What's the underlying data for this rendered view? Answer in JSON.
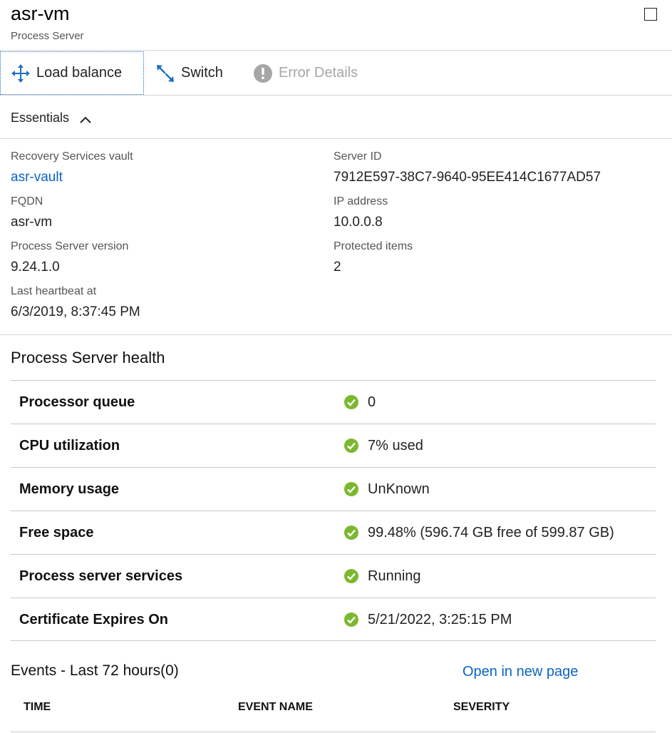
{
  "header": {
    "title": "asr-vm",
    "subtitle": "Process Server"
  },
  "toolbar": {
    "load_balance": "Load balance",
    "switch": "Switch",
    "error_details": "Error Details"
  },
  "essentials": {
    "label": "Essentials",
    "left": [
      {
        "label": "Recovery Services vault",
        "value": "asr-vault"
      },
      {
        "label": "FQDN",
        "value": "asr-vm"
      },
      {
        "label": "Process Server version",
        "value": "9.24.1.0"
      },
      {
        "label": "Last heartbeat at",
        "value": "6/3/2019, 8:37:45 PM"
      }
    ],
    "right": [
      {
        "label": "Server ID",
        "value": "7912E597-38C7-9640-95EE414C1677AD57"
      },
      {
        "label": "IP address",
        "value": "10.0.0.8"
      },
      {
        "label": "Protected items",
        "value": "2"
      }
    ]
  },
  "health": {
    "title": "Process Server health",
    "rows": [
      {
        "label": "Processor queue",
        "value": "0",
        "status": "ok"
      },
      {
        "label": "CPU utilization",
        "value": "7% used",
        "status": "ok"
      },
      {
        "label": "Memory usage",
        "value": "UnKnown",
        "status": "ok"
      },
      {
        "label": "Free space",
        "value": "99.48% (596.74 GB free of 599.87 GB)",
        "status": "ok"
      },
      {
        "label": "Process server services",
        "value": "Running",
        "status": "ok"
      },
      {
        "label": "Certificate Expires On",
        "value": "5/21/2022, 3:25:15 PM",
        "status": "ok"
      }
    ]
  },
  "events": {
    "title": "Events - Last 72 hours(0)",
    "open_link": "Open in new page",
    "columns": [
      "TIME",
      "EVENT NAME",
      "SEVERITY"
    ]
  },
  "colors": {
    "accent": "#0a64c4",
    "ok_green": "#7cb82f",
    "disabled": "#a6a6a6"
  },
  "icons": {
    "load_balance": "move-arrows-icon",
    "switch": "switch-arrows-icon",
    "error_details": "exclamation-circle-icon",
    "status_ok": "check-circle-icon"
  }
}
